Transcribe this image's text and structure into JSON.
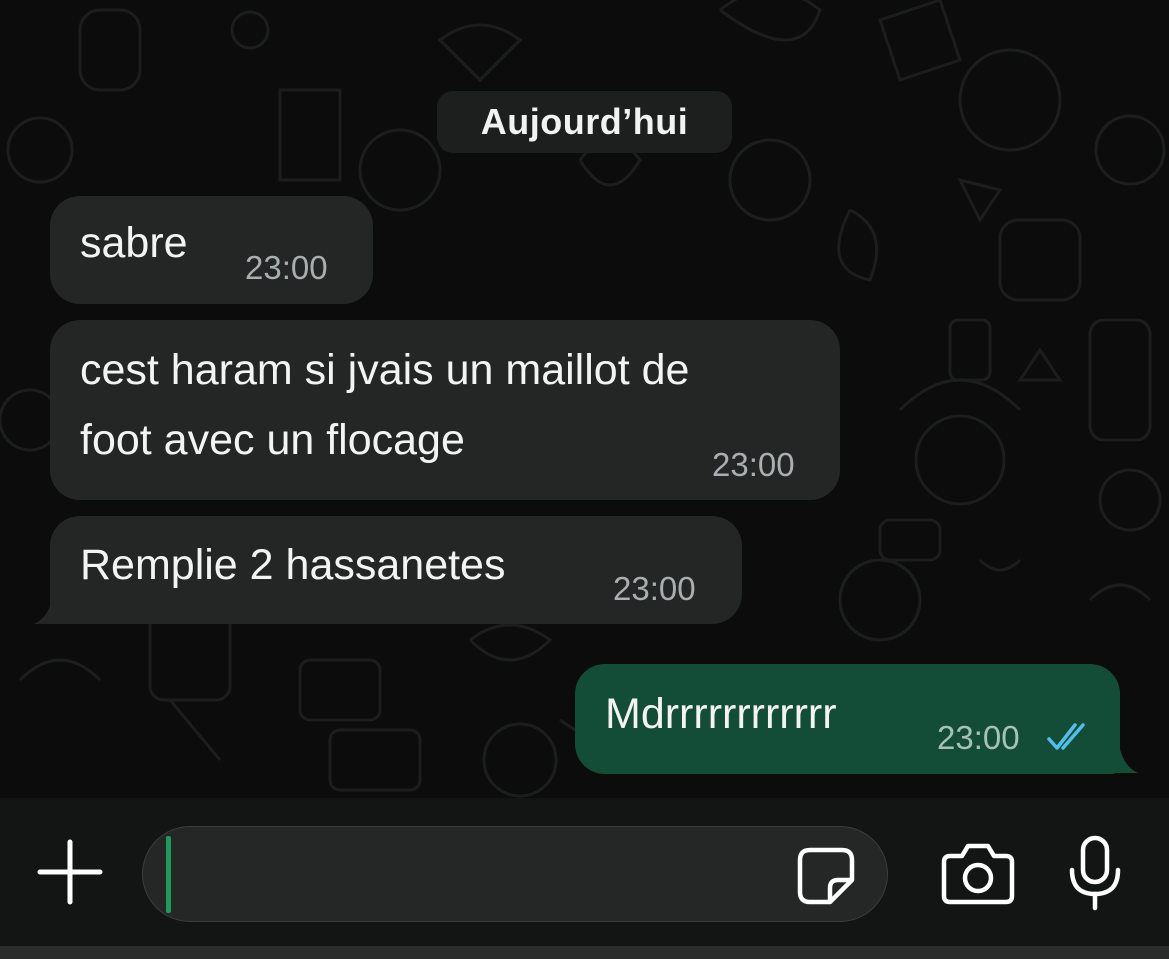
{
  "chat": {
    "date_label": "Aujourd’hui",
    "messages": [
      {
        "direction": "incoming",
        "lines": [
          "sabre"
        ],
        "time": "23:00"
      },
      {
        "direction": "incoming",
        "lines": [
          "cest haram si jvais un maillot de",
          "foot avec un flocage"
        ],
        "time": "23:00"
      },
      {
        "direction": "incoming",
        "lines": [
          "Remplie 2 hassanetes"
        ],
        "time": "23:00"
      },
      {
        "direction": "outgoing",
        "lines": [
          "Mdrrrrrrrrrrrr"
        ],
        "time": "23:00",
        "status": "read"
      }
    ]
  },
  "composer": {
    "attach_icon": "plus-icon",
    "input_value": "",
    "sticker_icon": "sticker-icon",
    "camera_icon": "camera-icon",
    "mic_icon": "microphone-icon"
  },
  "colors": {
    "background": "#0c0c0c",
    "incoming_bubble": "#242626",
    "outgoing_bubble": "#144d37",
    "read_ticks": "#53bdeb",
    "caret": "#1f9a5a"
  }
}
